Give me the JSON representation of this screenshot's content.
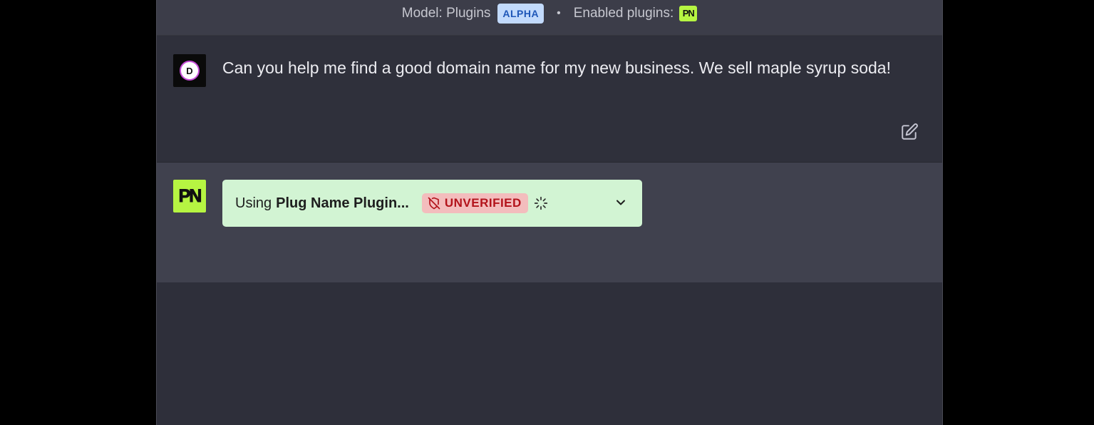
{
  "header": {
    "model_label": "Model: Plugins",
    "model_badge": "ALPHA",
    "separator": "•",
    "enabled_label": "Enabled plugins:",
    "plugin_logo_text": "PN"
  },
  "user_message": {
    "avatar_letter": "D",
    "text": "Can you help me find a good domain name for my new business. We sell maple syrup soda!",
    "edit_icon": "edit-icon"
  },
  "assistant_message": {
    "avatar_text": "PN",
    "plugin_status": {
      "prefix": "Using",
      "plugin_name": "Plug Name Plugin...",
      "badge": "UNVERIFIED",
      "badge_icon": "shield-off-icon",
      "loading_icon": "spinner-icon",
      "expand_icon": "chevron-down-icon"
    }
  },
  "colors": {
    "background": "#000000",
    "panel": "#2e2f3a",
    "assistant_row": "#40414e",
    "plugin_green": "#b6f542",
    "pill_green": "#d2f4d3",
    "unverified_bg": "#f3bdbd",
    "unverified_text": "#b3131b",
    "alpha_bg": "#c2dafc",
    "alpha_text": "#1f57b8"
  }
}
